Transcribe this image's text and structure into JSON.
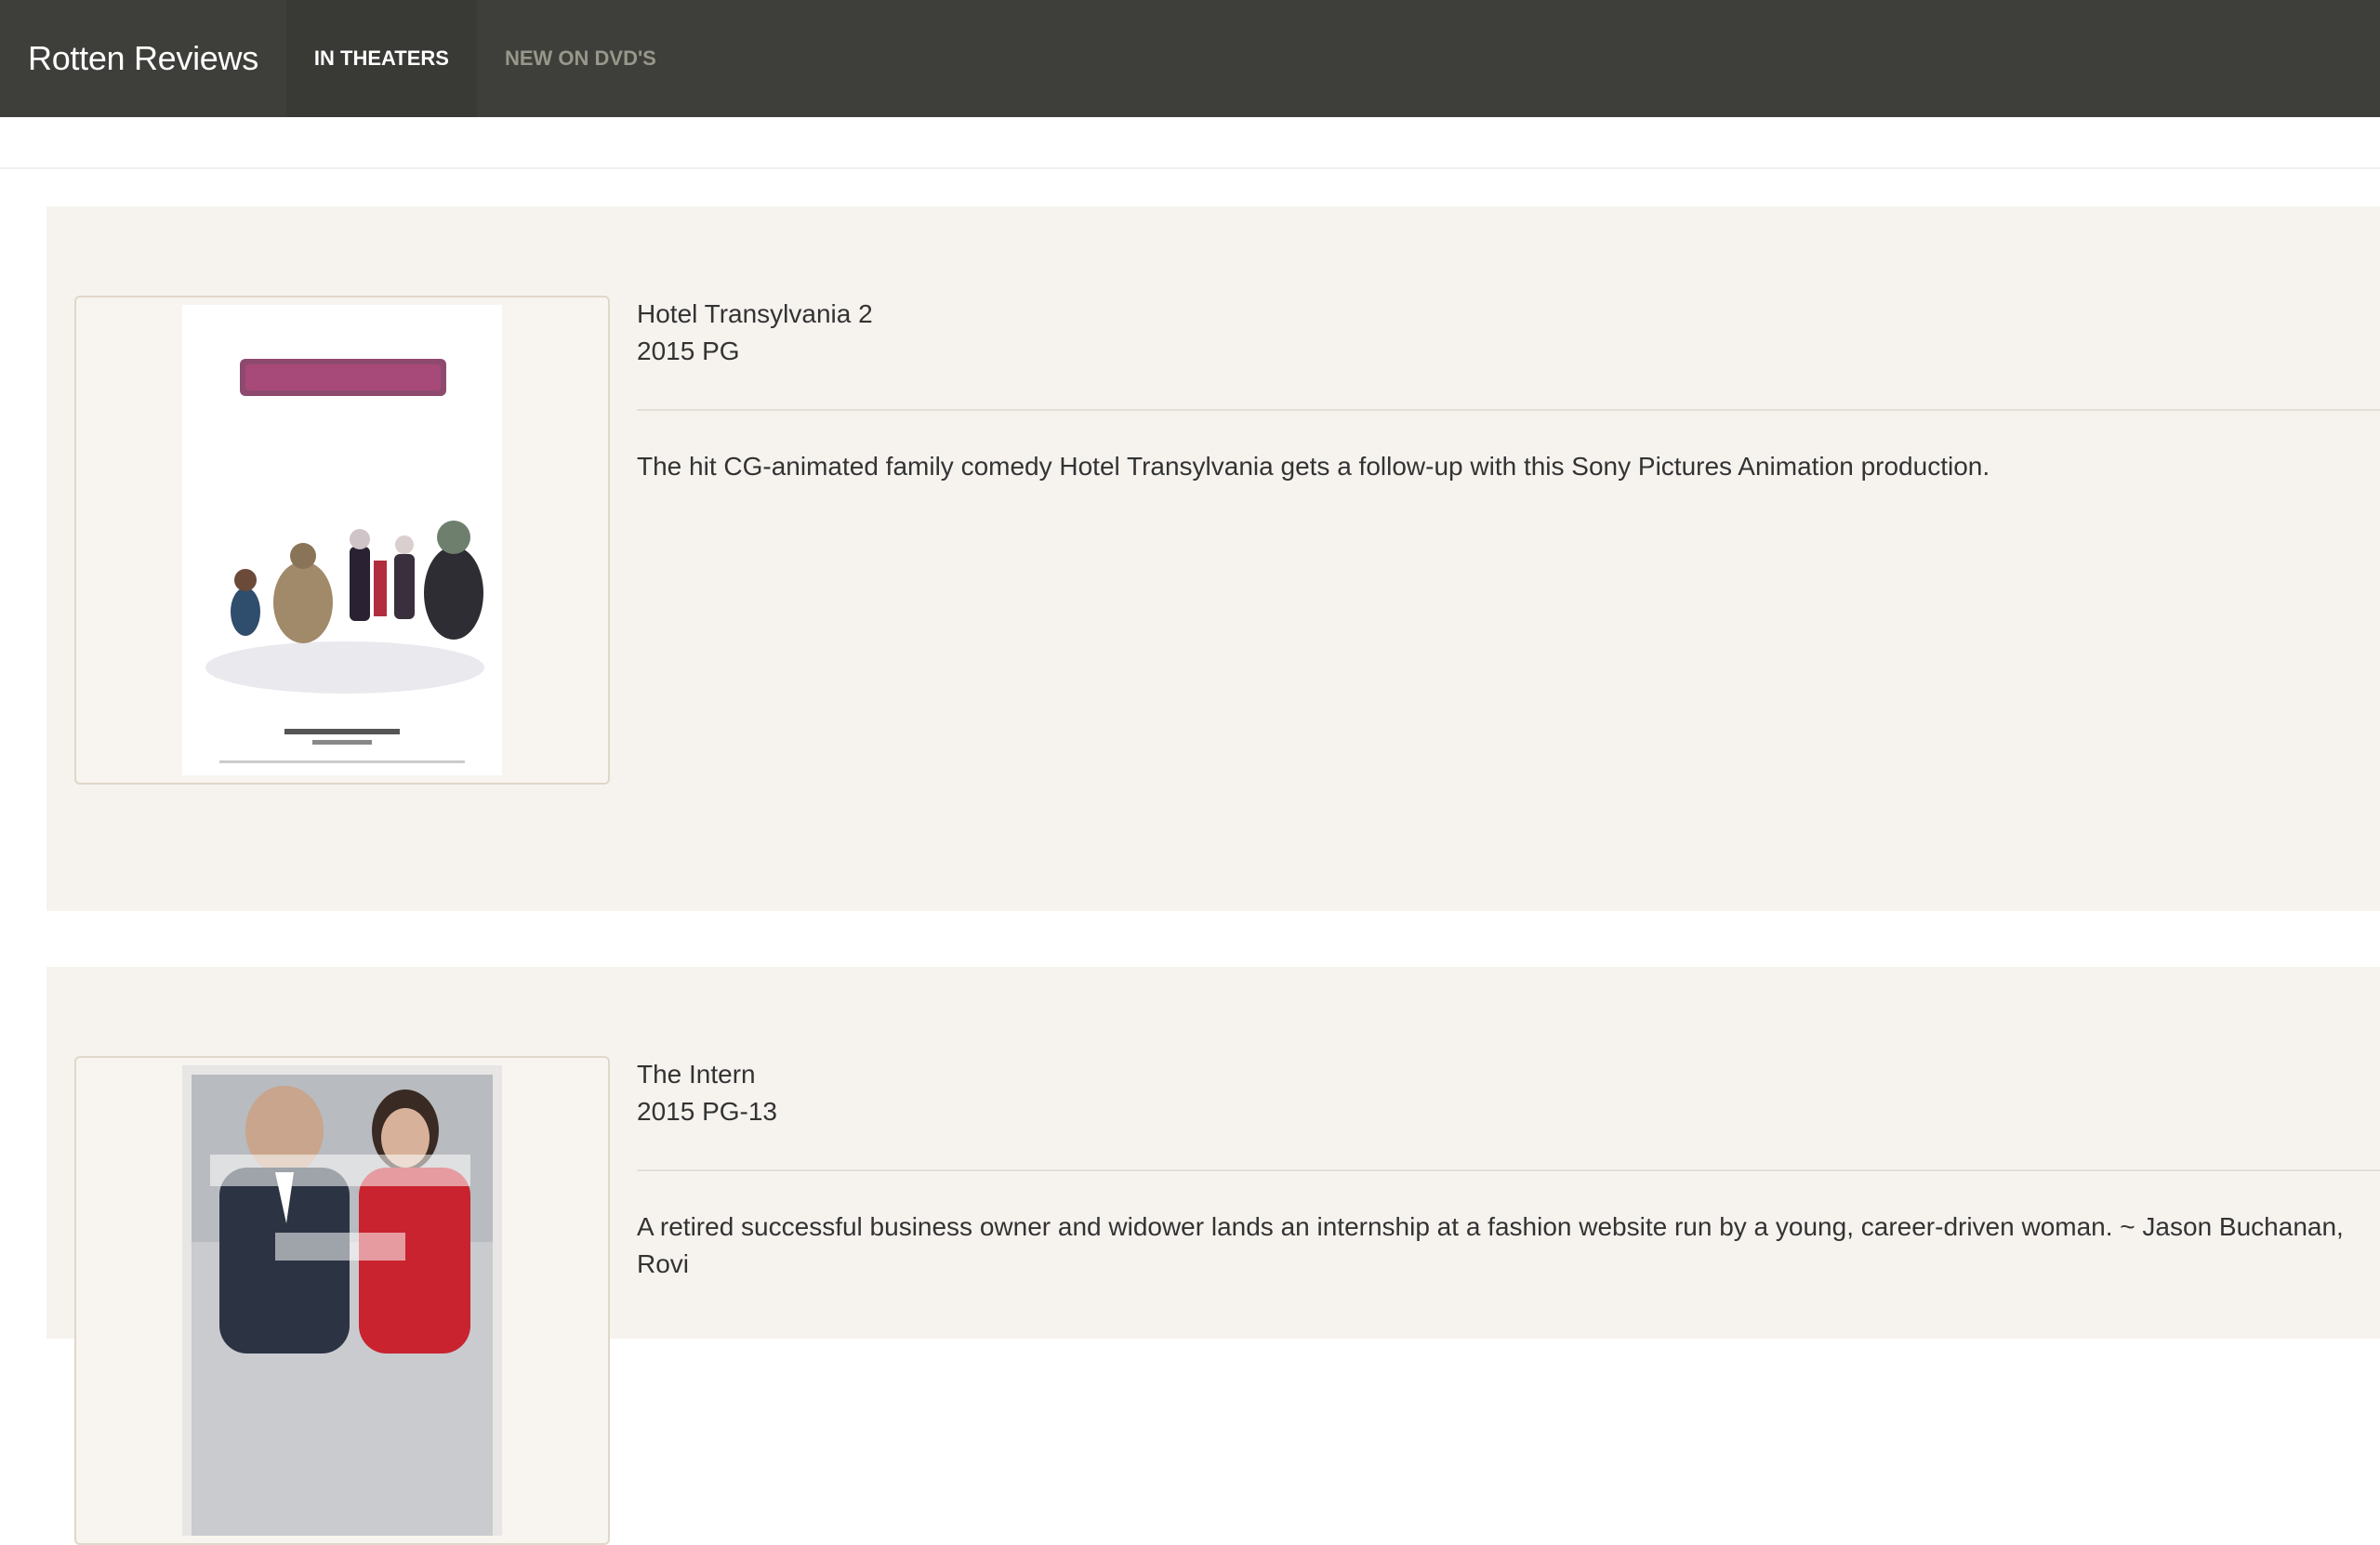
{
  "navbar": {
    "brand": "Rotten Reviews",
    "items": [
      {
        "label": "IN THEATERS",
        "active": true
      },
      {
        "label": "NEW ON DVD'S",
        "active": false
      }
    ]
  },
  "movies": [
    {
      "title": "Hotel Transylvania 2",
      "meta": "2015 PG",
      "synopsis": "The hit CG-animated family comedy Hotel Transylvania gets a follow-up with this Sony Pictures Animation production."
    },
    {
      "title": "The Intern",
      "meta": "2015 PG-13",
      "synopsis": "A retired successful business owner and widower lands an internship at a fashion website run by a young, career-driven woman. ~ Jason Buchanan, Rovi"
    }
  ],
  "colors": {
    "navbar_bg": "#3e3f3a",
    "navbar_active_bg": "#393a35",
    "nav_inactive_text": "#98978b",
    "card_bg": "#f6f3ef",
    "thumb_border": "#dfd7ca",
    "text": "#333333"
  }
}
